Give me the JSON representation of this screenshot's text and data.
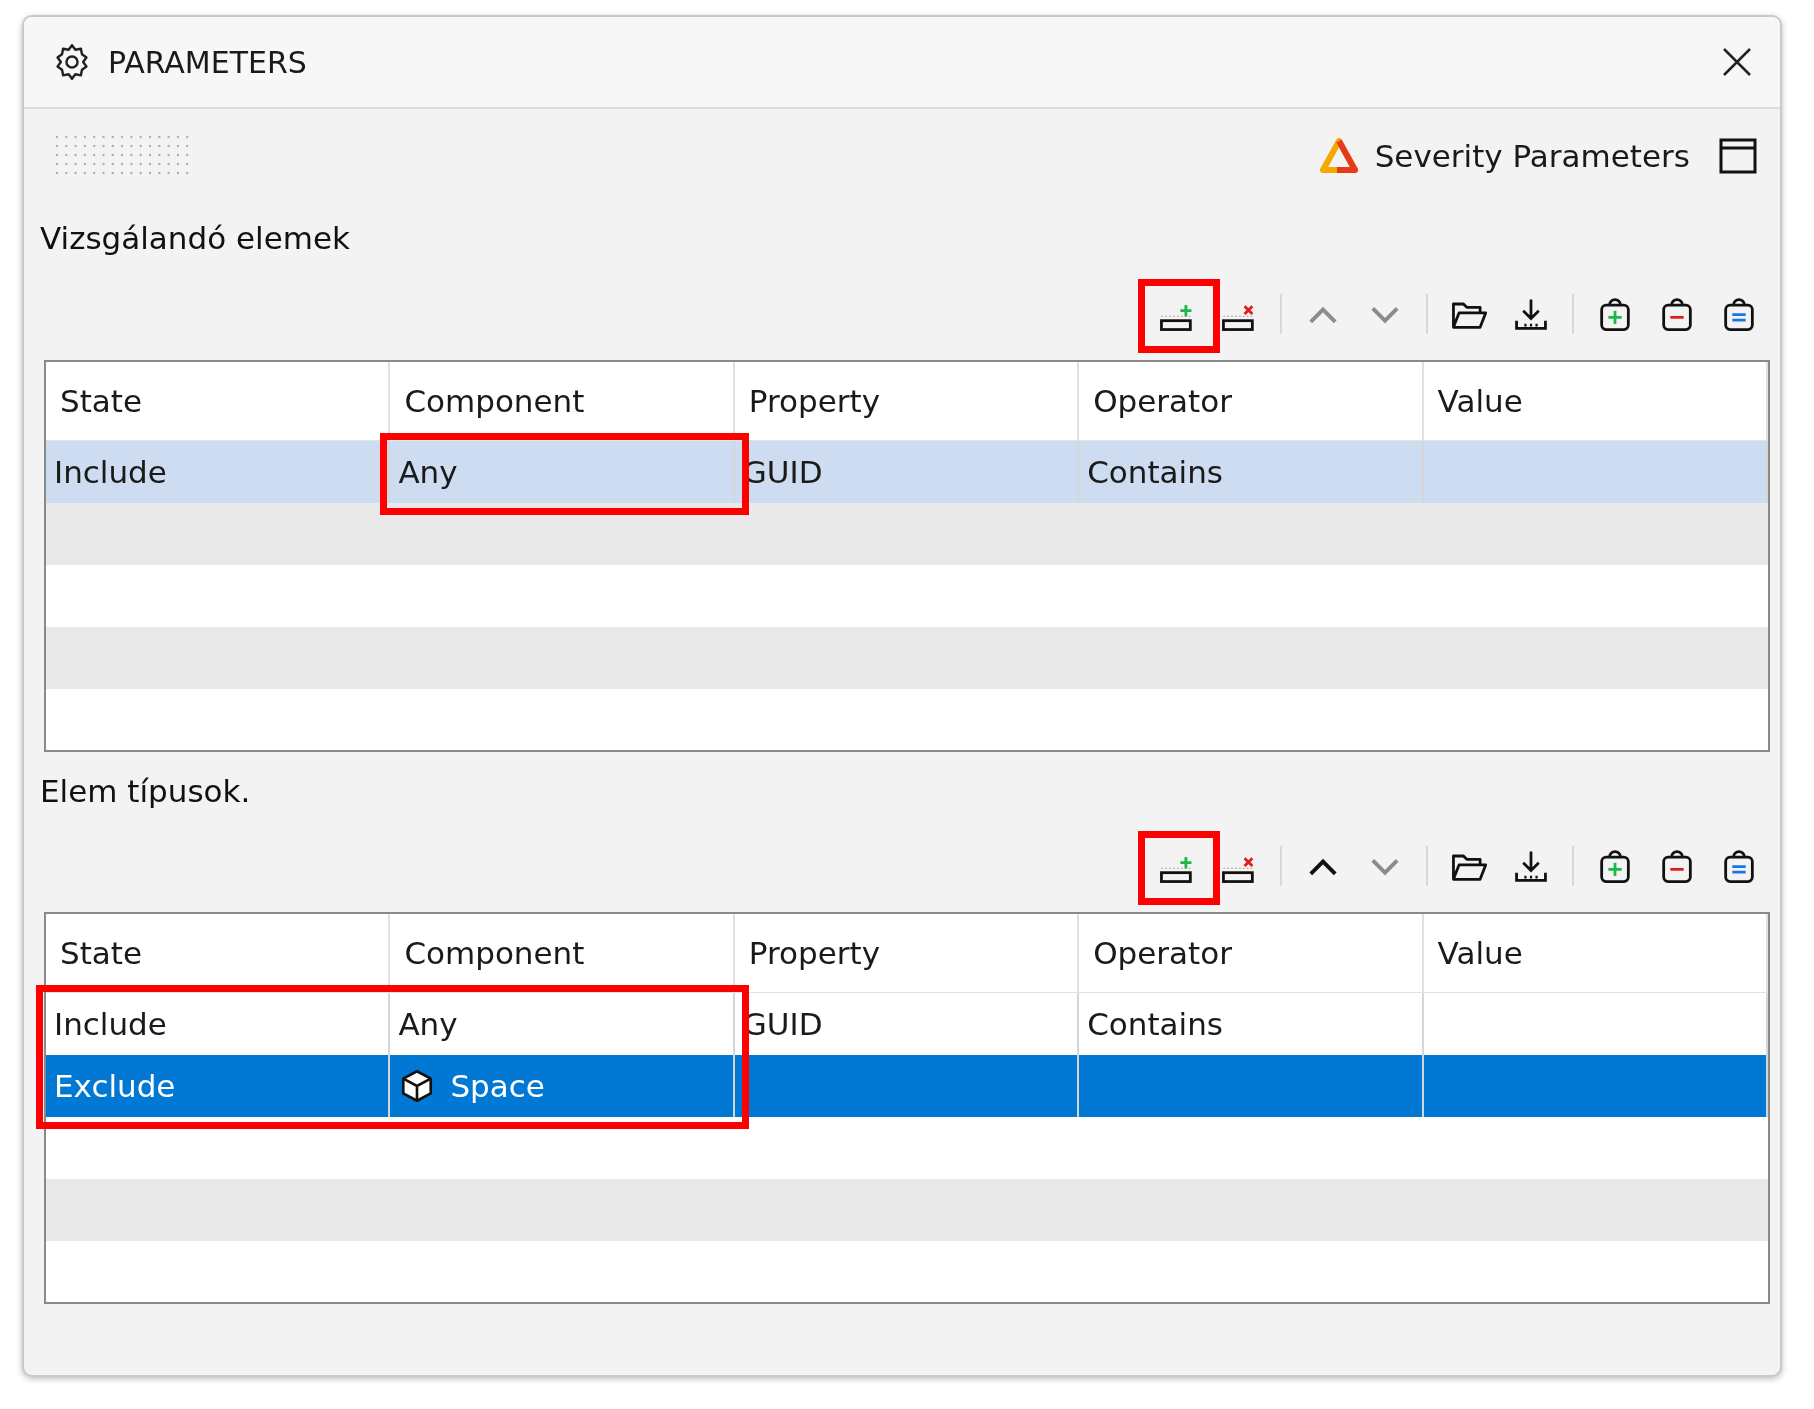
{
  "window": {
    "title": "PARAMETERS"
  },
  "header": {
    "severity_label": "Severity Parameters"
  },
  "sections": [
    {
      "label": "Vizsgálandó elemek",
      "toolbar": [
        {
          "kind": "add-row",
          "disabled": false,
          "highlighted": true,
          "separator_before": false
        },
        {
          "kind": "remove-row",
          "disabled": false,
          "highlighted": false,
          "separator_before": false
        },
        {
          "kind": "move-up",
          "disabled": true,
          "highlighted": false,
          "separator_before": true
        },
        {
          "kind": "move-down",
          "disabled": true,
          "highlighted": false,
          "separator_before": false
        },
        {
          "kind": "open",
          "disabled": false,
          "highlighted": false,
          "separator_before": true
        },
        {
          "kind": "download",
          "disabled": false,
          "highlighted": false,
          "separator_before": false
        },
        {
          "kind": "bag-add",
          "disabled": false,
          "highlighted": false,
          "separator_before": true
        },
        {
          "kind": "bag-remove",
          "disabled": false,
          "highlighted": false,
          "separator_before": false
        },
        {
          "kind": "bag-equal",
          "disabled": false,
          "highlighted": false,
          "separator_before": false
        }
      ],
      "table": {
        "focused": false,
        "columns": [
          "State",
          "Component",
          "Property",
          "Operator",
          "Value"
        ],
        "rows": [
          {
            "selected": true,
            "cells": [
              {
                "text": "Include",
                "highlighted": false
              },
              {
                "text": "Any",
                "highlighted": true
              },
              {
                "text": "GUID",
                "highlighted": false
              },
              {
                "text": "Contains",
                "highlighted": false
              }
            ]
          }
        ]
      }
    },
    {
      "label": "Elem típusok.",
      "toolbar": [
        {
          "kind": "add-row",
          "disabled": false,
          "highlighted": true,
          "separator_before": false
        },
        {
          "kind": "remove-row",
          "disabled": false,
          "highlighted": false,
          "separator_before": false
        },
        {
          "kind": "move-up",
          "disabled": false,
          "highlighted": false,
          "separator_before": true
        },
        {
          "kind": "move-down",
          "disabled": true,
          "highlighted": false,
          "separator_before": false
        },
        {
          "kind": "open",
          "disabled": false,
          "highlighted": false,
          "separator_before": true
        },
        {
          "kind": "download",
          "disabled": false,
          "highlighted": false,
          "separator_before": false
        },
        {
          "kind": "bag-add",
          "disabled": false,
          "highlighted": false,
          "separator_before": true
        },
        {
          "kind": "bag-remove",
          "disabled": false,
          "highlighted": false,
          "separator_before": false
        },
        {
          "kind": "bag-equal",
          "disabled": false,
          "highlighted": false,
          "separator_before": false
        }
      ],
      "table": {
        "focused": true,
        "columns": [
          "State",
          "Component",
          "Property",
          "Operator",
          "Value"
        ],
        "rows": [
          {
            "selected": false,
            "cells": [
              {
                "text": "Include",
                "highlighted": true
              },
              {
                "text": "Any",
                "highlighted": true
              },
              {
                "text": "GUID",
                "highlighted": false
              },
              {
                "text": "Contains",
                "highlighted": false
              }
            ]
          },
          {
            "selected": true,
            "cells": [
              {
                "text": "Exclude",
                "highlighted": true
              },
              {
                "text": "Space",
                "highlighted": true,
                "kind": "cube"
              }
            ]
          }
        ]
      }
    }
  ]
}
